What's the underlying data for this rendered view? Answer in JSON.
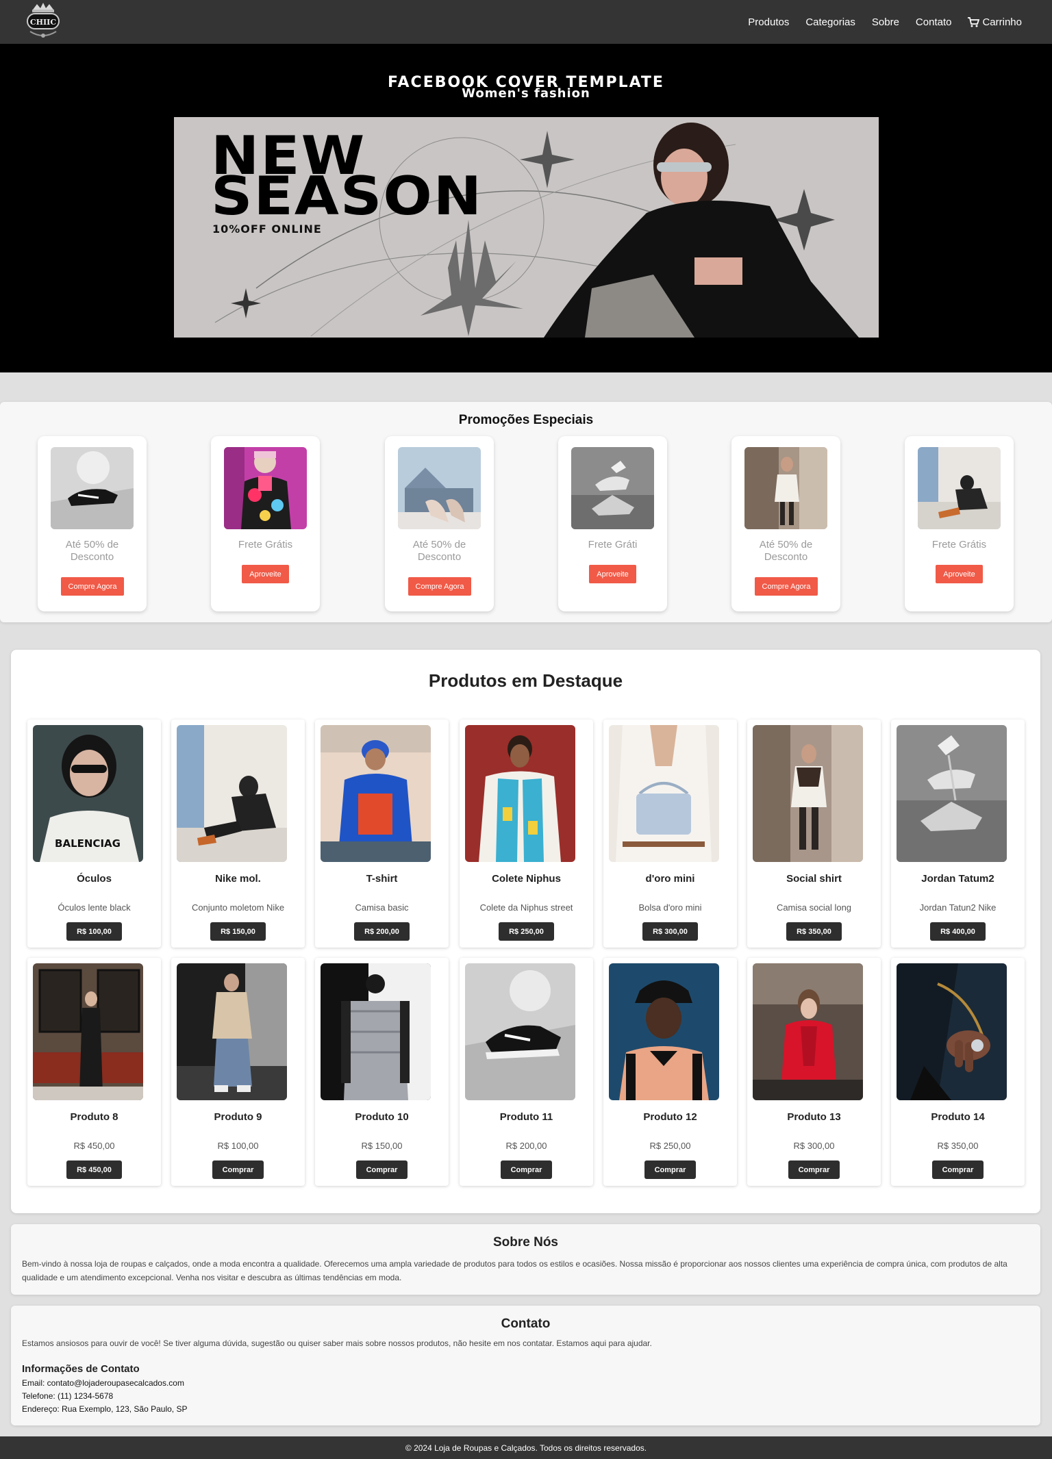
{
  "header": {
    "logo_text": "CHIIC",
    "nav": [
      "Produtos",
      "Categorias",
      "Sobre",
      "Contato",
      "Carrinho"
    ]
  },
  "hero": {
    "title": "FACEBOOK COVER TEMPLATE",
    "subtitle": "Women's fashion",
    "banner_line1": "NEW",
    "banner_line2": "SEASON",
    "banner_offer": "10%OFF ONLINE"
  },
  "promotions": {
    "title": "Promoções Especiais",
    "items": [
      {
        "text": "Até 50% de Desconto",
        "button": "Compre Agora"
      },
      {
        "text": "Frete Grátis",
        "button": "Aproveite"
      },
      {
        "text": "Até 50% de Desconto",
        "button": "Compre Agora"
      },
      {
        "text": "Frete Gráti",
        "button": "Aproveite"
      },
      {
        "text": "Até 50% de Desconto",
        "button": "Compre Agora"
      },
      {
        "text": "Frete Grátis",
        "button": "Aproveite"
      }
    ]
  },
  "featured": {
    "title": "Produtos em Destaque",
    "products": [
      {
        "name": "Óculos",
        "desc": "Óculos lente black",
        "button": "R$ 100,00"
      },
      {
        "name": "Nike mol.",
        "desc": "Conjunto moletom Nike",
        "button": "R$ 150,00"
      },
      {
        "name": "T-shirt",
        "desc": "Camisa basic",
        "button": "R$ 200,00"
      },
      {
        "name": "Colete Niphus",
        "desc": "Colete da Niphus street",
        "button": "R$ 250,00"
      },
      {
        "name": "d'oro mini",
        "desc": "Bolsa d'oro mini",
        "button": "R$ 300,00"
      },
      {
        "name": "Social shirt",
        "desc": "Camisa social long",
        "button": "R$ 350,00"
      },
      {
        "name": "Jordan Tatum2",
        "desc": "Jordan Tatun2 Nike",
        "button": "R$ 400,00"
      },
      {
        "name": "Produto 8",
        "desc": "R$ 450,00",
        "button": "R$ 450,00"
      },
      {
        "name": "Produto 9",
        "desc": "R$ 100,00",
        "button": "Comprar"
      },
      {
        "name": "Produto 10",
        "desc": "R$ 150,00",
        "button": "Comprar"
      },
      {
        "name": "Produto 11",
        "desc": "R$ 200,00",
        "button": "Comprar"
      },
      {
        "name": "Produto 12",
        "desc": "R$ 250,00",
        "button": "Comprar"
      },
      {
        "name": "Produto 13",
        "desc": "R$ 300,00",
        "button": "Comprar"
      },
      {
        "name": "Produto 14",
        "desc": "R$ 350,00",
        "button": "Comprar"
      }
    ]
  },
  "about": {
    "title": "Sobre Nós",
    "text": "Bem-vindo à nossa loja de roupas e calçados, onde a moda encontra a qualidade. Oferecemos uma ampla variedade de produtos para todos os estilos e ocasiões. Nossa missão é proporcionar aos nossos clientes uma experiência de compra única, com produtos de alta qualidade e um atendimento excepcional. Venha nos visitar e descubra as últimas tendências em moda."
  },
  "contact": {
    "title": "Contato",
    "intro": "Estamos ansiosos para ouvir de você! Se tiver alguma dúvida, sugestão ou quiser saber mais sobre nossos produtos, não hesite em nos contatar. Estamos aqui para ajudar.",
    "info_title": "Informações de Contato",
    "email": "Email: contato@lojaderoupasecalcados.com",
    "phone": "Telefone: (11) 1234-5678",
    "address": "Endereço: Rua Exemplo, 123, São Paulo, SP"
  },
  "footer": {
    "text": "© 2024 Loja de Roupas e Calçados. Todos os direitos reservados."
  },
  "colors": {
    "header_bg": "#343434",
    "promo_button": "#f05a47",
    "product_button": "#2e2e2e",
    "page_bg": "#e0e0e0"
  }
}
